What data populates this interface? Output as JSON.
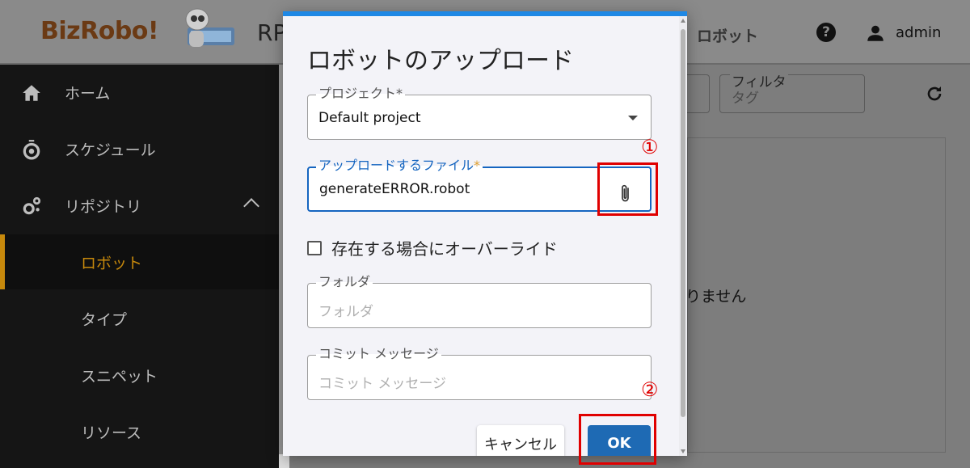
{
  "header": {
    "logo_text": "BizRobo!",
    "app_title": "RP",
    "nav_robot": "ロボット",
    "help_icon": "?",
    "user_name": "admin"
  },
  "sidebar": {
    "items": [
      {
        "label": "ホーム",
        "icon": "home-icon"
      },
      {
        "label": "スケジュール",
        "icon": "timer-icon"
      },
      {
        "label": "リポジトリ",
        "icon": "gears-icon"
      },
      {
        "label": "ロボット"
      },
      {
        "label": "タイプ"
      },
      {
        "label": "スニペット"
      },
      {
        "label": "リソース"
      }
    ]
  },
  "main": {
    "filter_label": "フィルタ",
    "filter_placeholder": "タグ",
    "empty_message": "りません"
  },
  "dialog": {
    "title": "ロボットのアップロード",
    "project": {
      "label": "プロジェクト",
      "required": "*",
      "value": "Default project"
    },
    "file": {
      "label": "アップロードするファイル",
      "required": "*",
      "value": "generateERROR.robot"
    },
    "override_label": "存在する場合にオーバーライド",
    "folder": {
      "label": "フォルダ",
      "placeholder": "フォルダ"
    },
    "commit": {
      "label": "コミット メッセージ",
      "placeholder": "コミット メッセージ"
    },
    "cancel_label": "キャンセル",
    "ok_label": "OK"
  },
  "annotations": {
    "marker1": "①",
    "marker2": "②",
    "color": "#e00000"
  }
}
